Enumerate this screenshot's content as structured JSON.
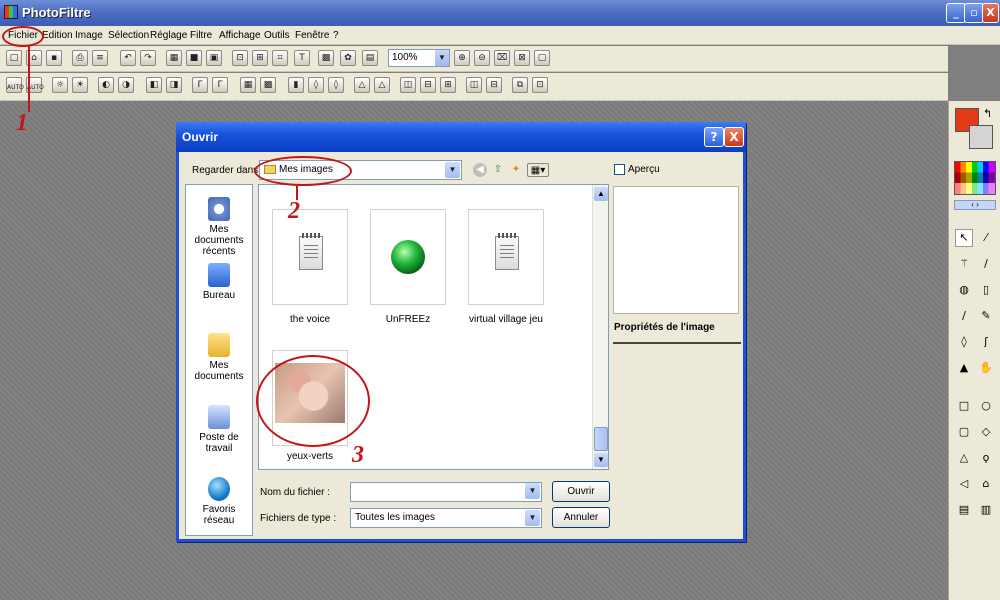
{
  "app": {
    "title": "PhotoFiltre"
  },
  "menu": [
    "Fichier",
    "Edition",
    "Image",
    "Sélection",
    "Réglage",
    "Filtre",
    "Affichage",
    "Outils",
    "Fenêtre",
    "?"
  ],
  "toolbar": {
    "zoom": "100%"
  },
  "toolbar2": {
    "auto1": "AUTO",
    "auto2": "AUTO"
  },
  "dialog": {
    "title": "Ouvrir",
    "help_glyph": "?",
    "close_glyph": "X",
    "look_in_label": "Regarder dans :",
    "look_in_value": "Mes images",
    "preview_label": "Aperçu",
    "properties_label": "Propriétés de l'image",
    "places": [
      "Mes documents récents",
      "Bureau",
      "Mes documents",
      "Poste de travail",
      "Favoris réseau"
    ],
    "files": [
      "the voice",
      "UnFREEz",
      "virtual village jeu",
      "yeux-verts"
    ],
    "filename_label": "Nom du fichier :",
    "filename_value": "",
    "filetype_label": "Fichiers de type :",
    "filetype_value": "Toutes les images",
    "open_button": "Ouvrir",
    "cancel_button": "Annuler"
  },
  "annotations": [
    "1",
    "2",
    "3"
  ],
  "colors": {
    "foreground": "#e33a16",
    "background": "#d4d4d4",
    "accent": "#c4151b"
  }
}
